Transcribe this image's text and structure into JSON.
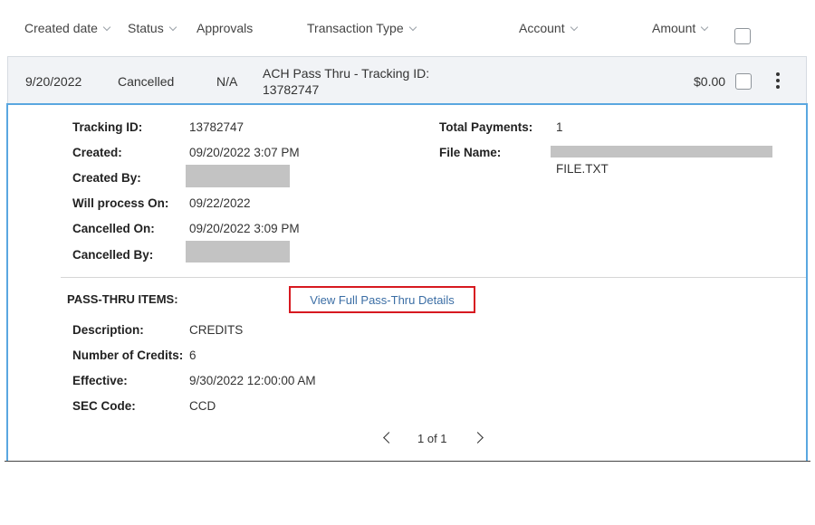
{
  "header": {
    "columns": [
      {
        "label": "Created date",
        "sortable": true
      },
      {
        "label": "Status",
        "sortable": true
      },
      {
        "label": "Approvals",
        "sortable": false
      },
      {
        "label": "Transaction Type",
        "sortable": true
      },
      {
        "label": "Account",
        "sortable": true
      },
      {
        "label": "Amount",
        "sortable": true
      }
    ]
  },
  "row": {
    "date": "9/20/2022",
    "status": "Cancelled",
    "approvals": "N/A",
    "transaction_type_line1": "ACH Pass Thru - Tracking ID:",
    "transaction_type_line2": "13782747",
    "amount": "$0.00"
  },
  "details": {
    "tracking_id_label": "Tracking ID:",
    "tracking_id": "13782747",
    "created_label": "Created:",
    "created": "09/20/2022 3:07 PM",
    "created_by_label": "Created By:",
    "will_process_label": "Will process On:",
    "will_process": "09/22/2022",
    "cancelled_on_label": "Cancelled On:",
    "cancelled_on": "09/20/2022 3:09 PM",
    "cancelled_by_label": "Cancelled By:",
    "total_payments_label": "Total Payments:",
    "total_payments": "1",
    "file_name_label": "File Name:",
    "file_name": "FILE.TXT"
  },
  "pass_thru": {
    "heading": "PASS-THRU ITEMS:",
    "link_label": "View Full Pass-Thru Details",
    "description_label": "Description:",
    "description": "CREDITS",
    "num_credits_label": "Number of Credits:",
    "num_credits": "6",
    "effective_label": "Effective:",
    "effective": "9/30/2022 12:00:00 AM",
    "sec_code_label": "SEC Code:",
    "sec_code": "CCD"
  },
  "pager": {
    "text": "1 of 1"
  },
  "colors": {
    "panel_border": "#5aa7e0",
    "highlight_box": "#d71920",
    "link": "#3b6ea5",
    "row_bg": "#f1f3f6",
    "redaction": "#c3c3c3"
  }
}
